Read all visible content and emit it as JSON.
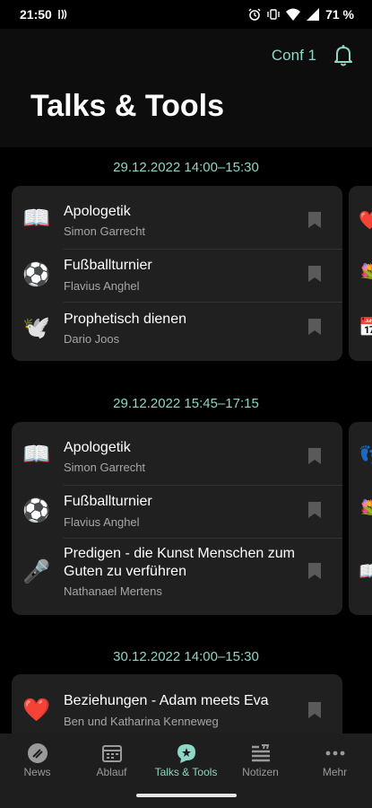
{
  "status_bar": {
    "time": "21:50",
    "battery": "71 %",
    "icons": [
      "nfc-icon",
      "alarm-icon",
      "vibrate-icon",
      "wifi-icon",
      "signal-icon",
      "battery-icon"
    ]
  },
  "header": {
    "conference_label": "Conf 1",
    "title": "Talks & Tools",
    "bell_icon": "bell-icon"
  },
  "colors": {
    "accent": "#8ed6c5",
    "background": "#000000",
    "card": "#202020",
    "speaker_text": "#a6a6a6",
    "nav_background": "#1e1e1e"
  },
  "slots": [
    {
      "time": "29.12.2022 14:00–15:30",
      "talks": [
        {
          "emoji": "📖",
          "title": "Apologetik",
          "speaker": "Simon Garrecht"
        },
        {
          "emoji": "⚽",
          "title": "Fußballturnier",
          "speaker": "Flavius Anghel"
        },
        {
          "emoji": "🕊️",
          "title": "Prophetisch dienen",
          "speaker": "Dario Joos"
        }
      ],
      "peek_emojis": [
        "❤️",
        "💐",
        "📅"
      ]
    },
    {
      "time": "29.12.2022 15:45–17:15",
      "talks": [
        {
          "emoji": "📖",
          "title": "Apologetik",
          "speaker": "Simon Garrecht"
        },
        {
          "emoji": "⚽",
          "title": "Fußballturnier",
          "speaker": "Flavius Anghel"
        },
        {
          "emoji": "🎤",
          "title": "Predigen - die Kunst Menschen zum Guten zu verführen",
          "speaker": "Nathanael Mertens"
        }
      ],
      "peek_emojis": [
        "👣",
        "💐",
        "📖"
      ]
    },
    {
      "time": "30.12.2022 14:00–15:30",
      "talks": [
        {
          "emoji": "❤️",
          "title": "Beziehungen - Adam meets Eva",
          "speaker": "Ben und Katharina Kenneweg"
        }
      ],
      "peek_emojis": []
    }
  ],
  "bottom_nav": [
    {
      "label": "News",
      "icon": "news-icon",
      "active": false
    },
    {
      "label": "Ablauf",
      "icon": "calendar-icon",
      "active": false
    },
    {
      "label": "Talks & Tools",
      "icon": "talk-bubble-icon",
      "active": true
    },
    {
      "label": "Notizen",
      "icon": "notes-icon",
      "active": false
    },
    {
      "label": "Mehr",
      "icon": "more-icon",
      "active": false
    }
  ]
}
